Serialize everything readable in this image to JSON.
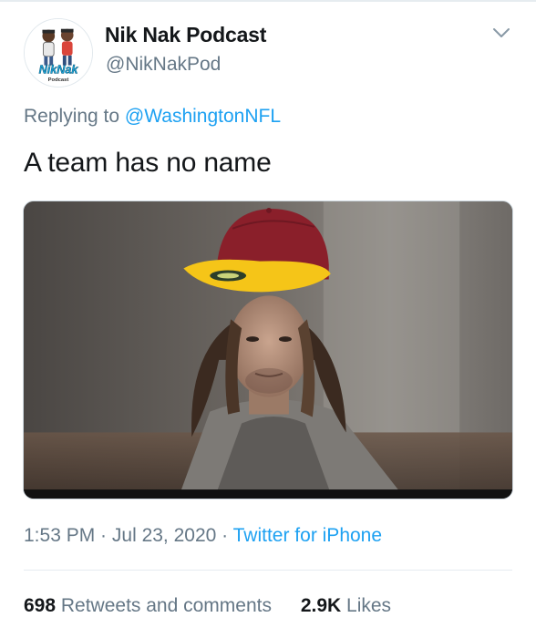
{
  "author": {
    "name": "Nik Nak Podcast",
    "handle": "@NikNakPod",
    "avatar_logo_text": "NikNak",
    "avatar_sub_text": "Podcast"
  },
  "reply": {
    "prefix": "Replying to ",
    "mention": "@WashingtonNFL"
  },
  "tweet": {
    "text": "A team has no name"
  },
  "media": {
    "description_icon": "photo-man-with-red-yellow-cap"
  },
  "meta": {
    "time": "1:53 PM",
    "separator1": " · ",
    "date": "Jul 23, 2020",
    "separator2": " · ",
    "source": "Twitter for iPhone"
  },
  "stats": {
    "retweets_count": "698",
    "retweets_label": " Retweets and comments",
    "likes_count": "2.9K",
    "likes_label": " Likes"
  },
  "colors": {
    "link": "#1da1f2",
    "secondary_text": "#657786",
    "primary_text": "#14171a",
    "cap_crown": "#8a1f2a",
    "cap_brim": "#f5c518"
  }
}
